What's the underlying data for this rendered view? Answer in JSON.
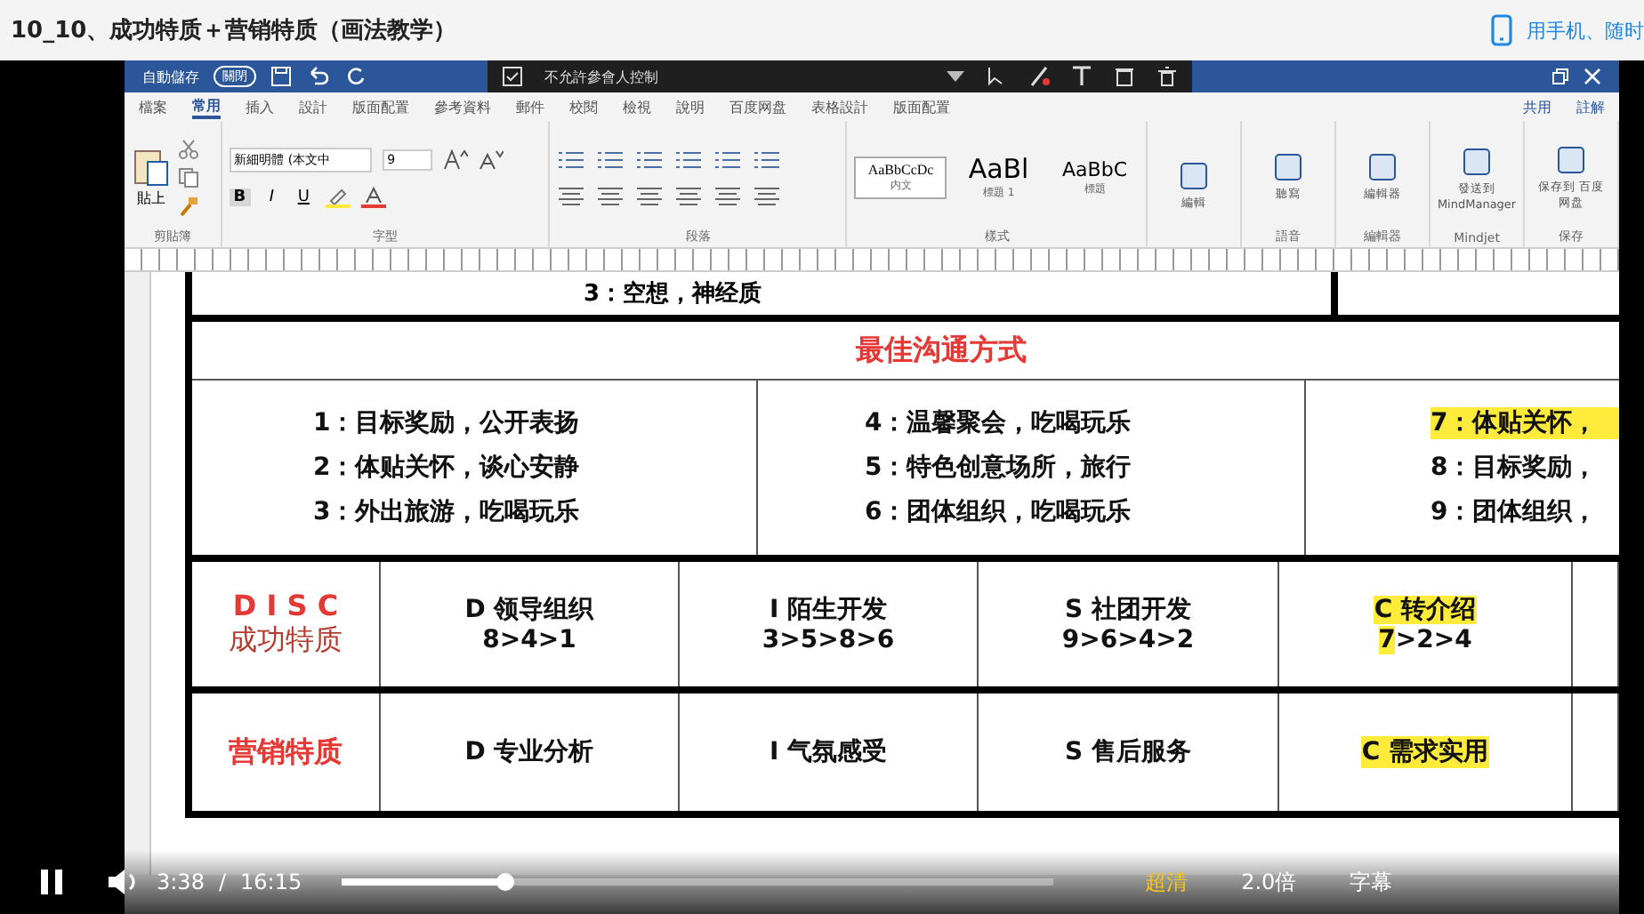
{
  "header": {
    "title": "10_10、成功特质＋营销特质（画法教学）",
    "mobile_link": "用手机、随时"
  },
  "word": {
    "title_bar": {
      "autosave_label": "自動儲存",
      "autosave_on": false,
      "autosave_state": "關閉"
    },
    "meeting_toolbar": {
      "control_label": "不允許參會人控制"
    },
    "ribbon_tabs": [
      {
        "label": "檔案",
        "selected": false
      },
      {
        "label": "常用",
        "selected": true
      },
      {
        "label": "插入",
        "selected": false
      },
      {
        "label": "設計",
        "selected": false
      },
      {
        "label": "版面配置",
        "selected": false
      },
      {
        "label": "參考資料",
        "selected": false
      },
      {
        "label": "郵件",
        "selected": false
      },
      {
        "label": "校閱",
        "selected": false
      },
      {
        "label": "檢視",
        "selected": false
      },
      {
        "label": "說明",
        "selected": false
      },
      {
        "label": "百度网盘",
        "selected": false
      },
      {
        "label": "表格設計",
        "selected": false
      },
      {
        "label": "版面配置",
        "selected": false
      }
    ],
    "share_label": "共用",
    "comments_label": "註解",
    "paste_label": "貼上",
    "font_name": "新細明體 (本文中",
    "font_size": "9",
    "format_buttons": [
      "B",
      "I",
      "U"
    ],
    "styles": [
      {
        "sample": "AaBbCcDc",
        "name": "内文",
        "selected": true
      },
      {
        "sample": "AaBl",
        "name": "標題 1",
        "selected": false
      },
      {
        "sample": "AaBbC",
        "name": "標題",
        "selected": false
      }
    ],
    "groups": [
      "剪貼簿",
      "字型",
      "段落",
      "樣式"
    ],
    "tools": [
      {
        "label": "編輯"
      },
      {
        "label": "聽寫",
        "group": "語音"
      },
      {
        "label": "編輯器",
        "group": "編輯器"
      },
      {
        "label": "發送到 MindManager",
        "group": "Mindjet"
      },
      {
        "label": "保存到 百度网盘",
        "group": "保存"
      }
    ]
  },
  "document": {
    "top_row_text": "3：空想，神经质",
    "section_heading": "最佳沟通方式",
    "communication_columns": [
      [
        {
          "text": "1：目标奖励，公开表扬",
          "highlighted": false
        },
        {
          "text": "2：体贴关怀，谈心安静",
          "highlighted": false
        },
        {
          "text": "3：外出旅游，吃喝玩乐",
          "highlighted": false
        }
      ],
      [
        {
          "text": "4：温馨聚会，吃喝玩乐",
          "highlighted": false
        },
        {
          "text": "5：特色创意场所，旅行",
          "highlighted": false
        },
        {
          "text": "6：团体组织，吃喝玩乐",
          "highlighted": false
        }
      ],
      [
        {
          "text": "7：体贴关怀，",
          "highlighted": true
        },
        {
          "text": "8：目标奖励，",
          "highlighted": false
        },
        {
          "text": "9：团体组织，",
          "highlighted": false
        }
      ]
    ],
    "disc_row": {
      "label_top": "D I S C",
      "label_bottom": "成功特质",
      "cells": [
        {
          "lines": [
            [
              {
                "text": "D 领导组织",
                "highlighted": false
              }
            ],
            [
              {
                "text": "8>4>1",
                "highlighted": false
              }
            ]
          ]
        },
        {
          "lines": [
            [
              {
                "text": "I 陌生开发",
                "highlighted": false
              }
            ],
            [
              {
                "text": "3>5>8>6",
                "highlighted": false
              }
            ]
          ]
        },
        {
          "lines": [
            [
              {
                "text": "S 社团开发",
                "highlighted": false
              }
            ],
            [
              {
                "text": "9>6>4>2",
                "highlighted": false
              }
            ]
          ]
        },
        {
          "lines": [
            [
              {
                "text": "C 转介绍",
                "highlighted": true
              }
            ],
            [
              {
                "text": "7",
                "highlighted": true
              },
              {
                "text": ">2>4",
                "highlighted": false
              }
            ]
          ]
        }
      ]
    },
    "marketing_row": {
      "label": "营销特质",
      "cells": [
        {
          "text": "D 专业分析",
          "highlighted": false
        },
        {
          "text": "I 气氛感受",
          "highlighted": false
        },
        {
          "text": "S 售后服务",
          "highlighted": false
        },
        {
          "text": "C 需求实用",
          "highlighted": true
        }
      ]
    }
  },
  "player": {
    "playing": true,
    "time": "3:38",
    "time_separator": "/",
    "duration": "16:15",
    "level": 0.23,
    "quality": "超清",
    "speed": "2.0倍",
    "subtitles": "字幕"
  }
}
